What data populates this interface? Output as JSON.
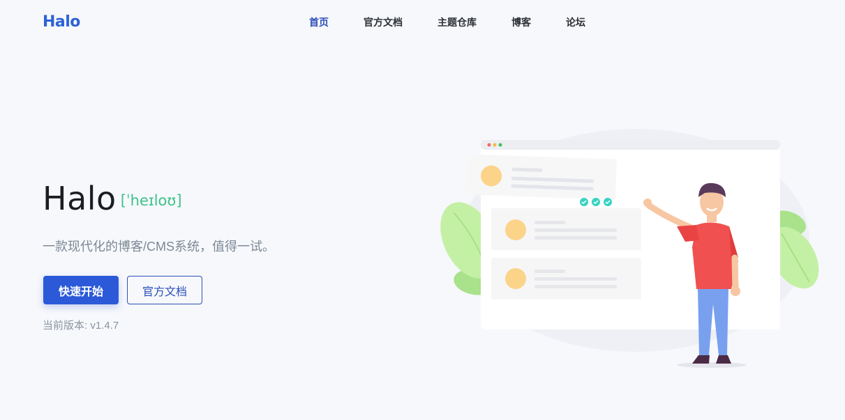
{
  "brand": {
    "logo_text": "Halo",
    "color": "#2e62d6"
  },
  "nav": {
    "items": [
      {
        "label": "首页",
        "active": true
      },
      {
        "label": "官方文档",
        "active": false
      },
      {
        "label": "主题仓库",
        "active": false
      },
      {
        "label": "博客",
        "active": false
      },
      {
        "label": "论坛",
        "active": false
      }
    ]
  },
  "hero": {
    "title": "Halo",
    "phonetic": "[ˈheɪloʊ]",
    "subtitle": "一款现代化的博客/CMS系统，值得一试。",
    "primary_button": "快速开始",
    "secondary_button": "官方文档",
    "version": "当前版本: v1.4.7"
  },
  "colors": {
    "accent": "#2b59d8",
    "phonetic": "#3dc38a",
    "background": "#f7f8fc"
  },
  "illustration": {
    "icon": "person-presenting-browser-illustration"
  }
}
